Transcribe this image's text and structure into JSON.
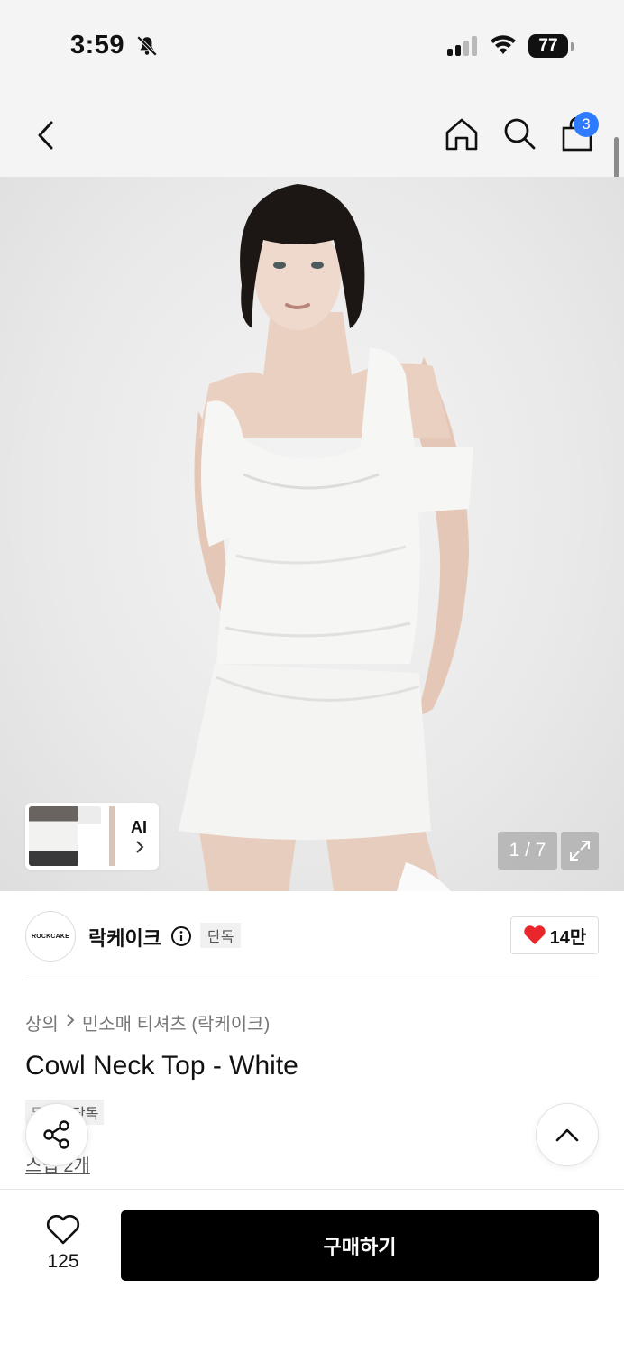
{
  "status_bar": {
    "time": "3:59",
    "battery": "77"
  },
  "nav": {
    "cart_count": "3"
  },
  "gallery": {
    "counter": "1 / 7",
    "ai_label": "AI"
  },
  "brand": {
    "logo_text": "ROCKCAKE",
    "name": "락케이크",
    "exclusive_tag": "단독",
    "likes": "14만"
  },
  "product": {
    "breadcrumb": [
      "상의",
      "민소매 티셔츠 (락케이크)"
    ],
    "title": "Cowl Neck Top - White",
    "tag_prefix": "무료",
    "tag": "단독",
    "review_link": "스냅 2개"
  },
  "bottom": {
    "wish_count": "125",
    "buy_label": "구매하기"
  },
  "colors": {
    "accent_blue": "#2f7bff",
    "heart_red": "#e8262b",
    "buy_bg": "#000000"
  }
}
